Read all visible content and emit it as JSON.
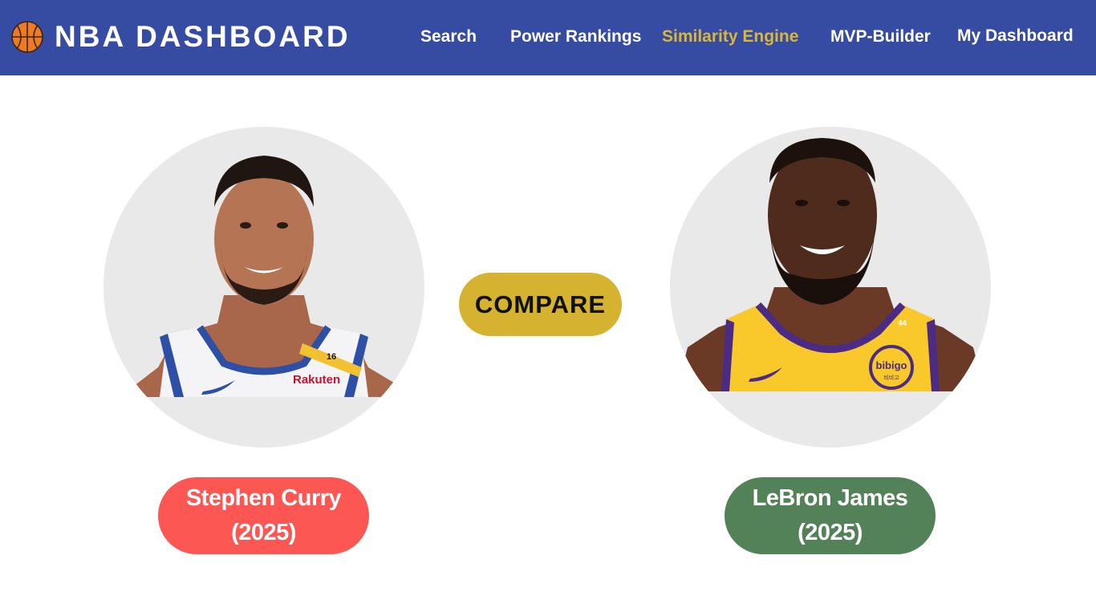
{
  "app": {
    "title": "NBA DASHBOARD",
    "logo_icon": "basketball-icon"
  },
  "nav": {
    "items": [
      {
        "label": "Search",
        "active": false
      },
      {
        "label": "Power Rankings",
        "active": false
      },
      {
        "label": "Similarity Engine",
        "active": true
      },
      {
        "label": "MVP-Builder",
        "active": false
      },
      {
        "label": "My Dashboard",
        "active": false
      }
    ],
    "active_color": "#d8b73a"
  },
  "compare": {
    "label": "COMPARE",
    "color": "#d5b330"
  },
  "players": [
    {
      "name": "Stephen Curry",
      "year": "(2025)",
      "pill_color": "#fd5753",
      "jersey": {
        "number": "16",
        "sponsor": "Rakuten",
        "colors": [
          "#ffffff",
          "#2a4ea8",
          "#f2c131"
        ]
      }
    },
    {
      "name": "LeBron James",
      "year": "(2025)",
      "pill_color": "#548258",
      "jersey": {
        "number": "44",
        "sponsor": "bibigo",
        "sponsor_sub": "비비고",
        "colors": [
          "#f9c82a",
          "#4b2b83"
        ]
      }
    }
  ]
}
